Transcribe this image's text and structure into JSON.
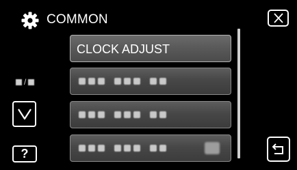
{
  "header": {
    "title": "COMMON",
    "icon": "gear-icon"
  },
  "menu": {
    "items": [
      {
        "label": "CLOCK ADJUST",
        "state": "selected"
      },
      {
        "label": "",
        "state": "blurred"
      },
      {
        "label": "",
        "state": "blurred"
      },
      {
        "label": "",
        "state": "blurred"
      }
    ]
  },
  "pager": {
    "separator": "/"
  },
  "buttons": {
    "help_label": "?",
    "close_icon": "close-icon",
    "down_icon": "chevron-down-icon",
    "back_icon": "return-icon"
  },
  "colors": {
    "background": "#000000",
    "item_fill": "#4a4a4a",
    "text": "#ffffff"
  }
}
